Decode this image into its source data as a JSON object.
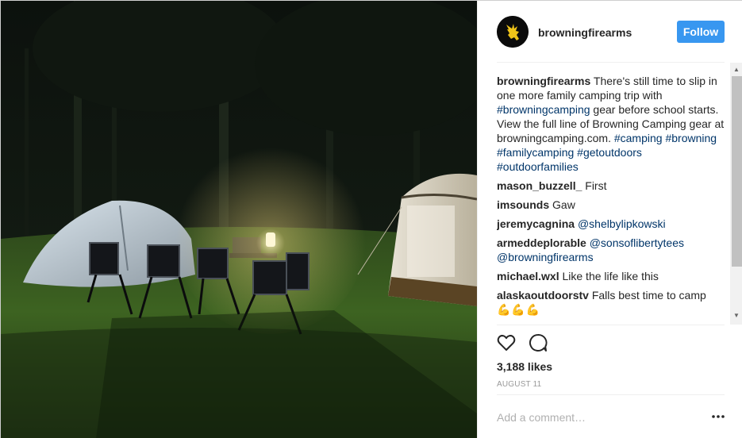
{
  "post": {
    "username": "browningfirearms",
    "follow_label": "Follow",
    "caption_user": "browningfirearms",
    "caption_text_1": " There's still time to slip in one more family camping trip with ",
    "caption_tag_1": "#browningcamping",
    "caption_text_2": " gear before school starts. View the full line of Browning Camping gear at browningcamping.com. ",
    "caption_tags": [
      "#camping",
      "#browning",
      "#familycamping",
      "#getoutdoors",
      "#outdoorfamilies"
    ],
    "likes": "3,188 likes",
    "date": "AUGUST 11",
    "add_comment_placeholder": "Add a comment…"
  },
  "comments": [
    {
      "user": "mason_buzzell_",
      "text": " First",
      "mentions": []
    },
    {
      "user": "imsounds",
      "text": " Gaw",
      "mentions": []
    },
    {
      "user": "jeremycagnina",
      "text": " ",
      "mentions": [
        "@shelbylipkowski"
      ]
    },
    {
      "user": "armeddeplorable",
      "text": " ",
      "mentions": [
        "@sonsoflibertytees",
        "@browningfirearms"
      ]
    },
    {
      "user": "michael.wxl",
      "text": " Like the life like this",
      "mentions": []
    },
    {
      "user": "alaskaoutdoorstv",
      "text": " Falls best time to camp",
      "mentions": [],
      "emoji": "💪💪💪"
    }
  ],
  "icons": {
    "avatar": "buckmark-logo",
    "like": "heart-icon",
    "comment": "comment-bubble-icon",
    "more": "more-options-icon"
  },
  "colors": {
    "accent": "#3897f0",
    "link": "#003569",
    "muted": "#999999"
  }
}
